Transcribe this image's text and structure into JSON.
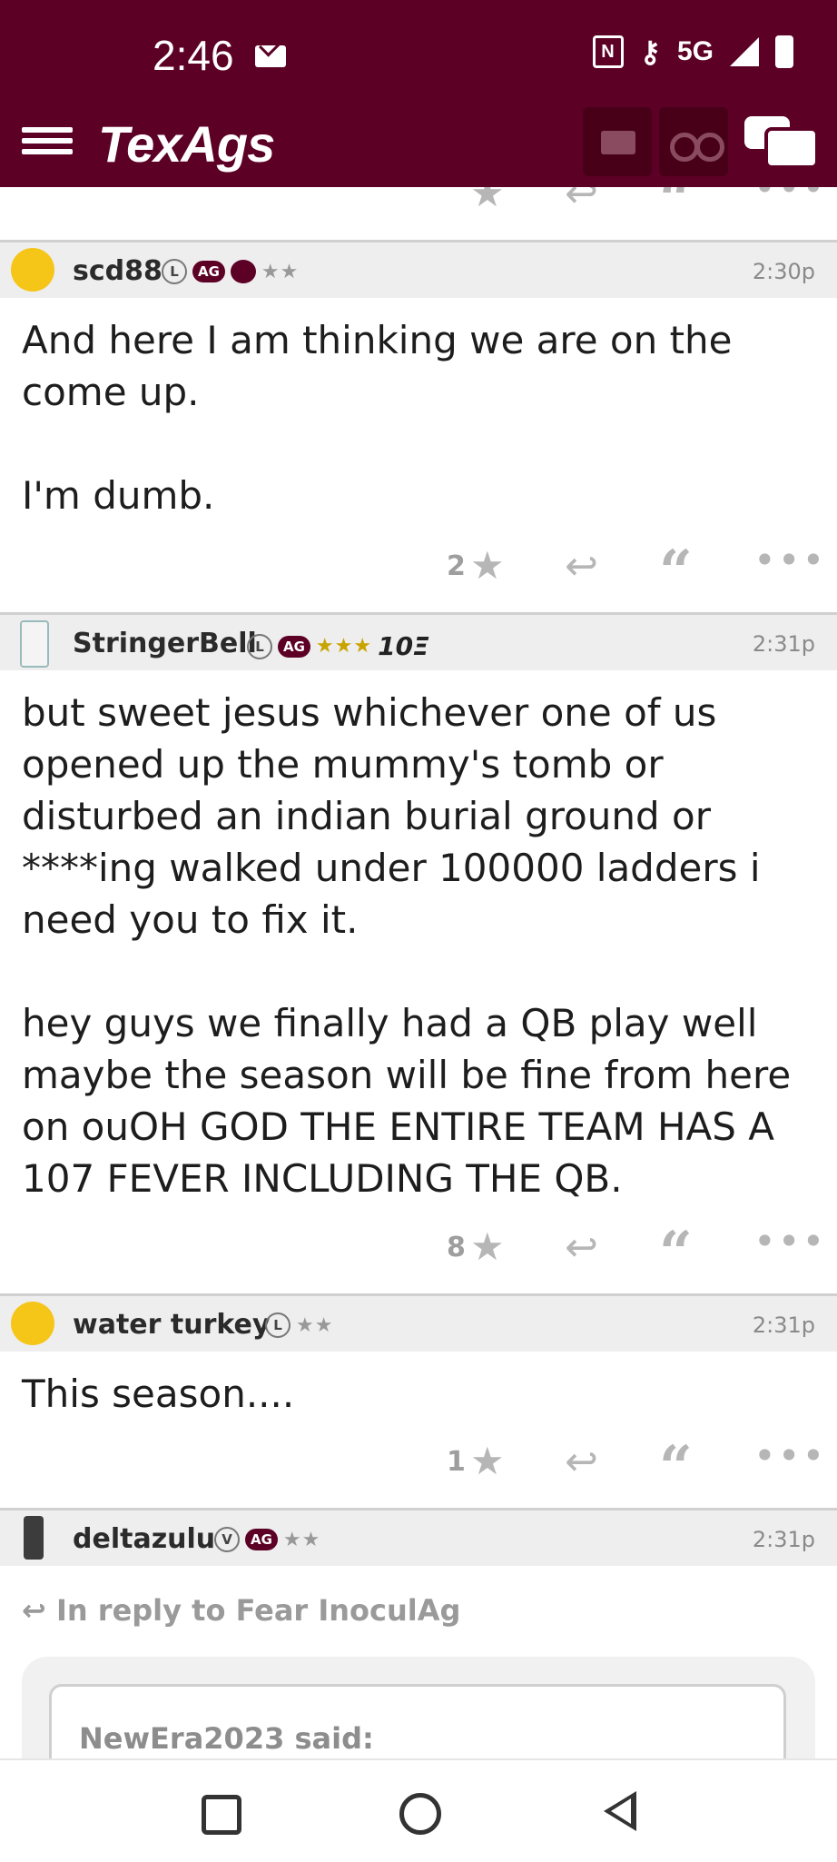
{
  "status_bar": {
    "time": "2:46",
    "network": "5G"
  },
  "app_bar": {
    "logo": "TexAgs",
    "icons": [
      "menu-icon",
      "mail-icon",
      "binoculars-icon",
      "chat-icon"
    ]
  },
  "posts": [
    {
      "username": "scd88",
      "badges": [
        "L",
        "AG"
      ],
      "stars": "★★",
      "time": "2:30p",
      "body": "And here I am thinking we are on the\ncome up.\n\nI'm dumb.",
      "star_count": "2"
    },
    {
      "username": "StringerBell",
      "badges": [
        "L",
        "AG"
      ],
      "stars": "★★★",
      "extra_badge": "10Ξ",
      "time": "2:31p",
      "body": "but sweet jesus whichever one of us\nopened up the mummy's tomb or\ndisturbed an indian burial ground or\n****ing walked under 100000 ladders i\nneed you to fix it.\n\nhey guys we finally had a QB play well\nmaybe the season will be fine from here\non ouOH GOD THE ENTIRE TEAM HAS A\n107 FEVER INCLUDING THE QB.",
      "star_count": "8"
    },
    {
      "username": "water turkey",
      "badges": [
        "L"
      ],
      "stars": "★★",
      "time": "2:31p",
      "body": "This season....",
      "star_count": "1"
    },
    {
      "username": "deltazulu",
      "badges": [
        "V",
        "AG"
      ],
      "stars": "★★",
      "time": "2:31p",
      "reply_to": "In reply to Fear InoculAg",
      "quote_author": "NewEra2023 said:"
    }
  ],
  "action_icons": [
    "star-icon",
    "reply-icon",
    "quote-icon",
    "more-icon"
  ],
  "colors": {
    "brand": "#5c0025",
    "header_bg": "#eeeeee",
    "muted": "#9e9e9e"
  }
}
